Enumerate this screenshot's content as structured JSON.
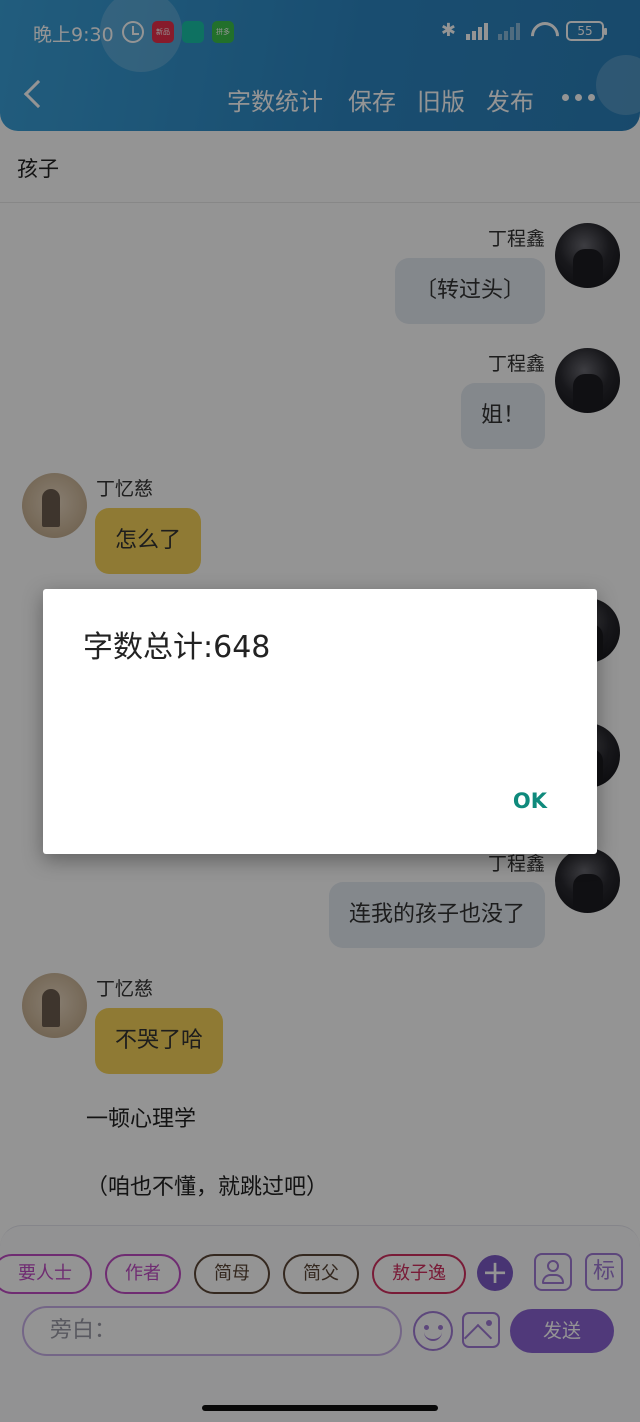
{
  "status_bar": {
    "time": "晚上9:30",
    "battery": "55",
    "app_icons": [
      {
        "label": "新品",
        "color": "#e8304a"
      },
      {
        "label": "",
        "color": "#19c3a8"
      },
      {
        "label": "拼多",
        "color": "#3bc24b"
      }
    ]
  },
  "toolbar": {
    "actions": [
      "字数统计",
      "保存",
      "旧版",
      "发布"
    ]
  },
  "title": "孩子",
  "messages": [
    {
      "side": "right",
      "name": "丁程鑫",
      "text": "〔转过头〕"
    },
    {
      "side": "right",
      "name": "丁程鑫",
      "text": "姐！"
    },
    {
      "side": "left",
      "name": "丁忆慈",
      "text": "怎么了"
    },
    {
      "side": "right",
      "name": "丁程鑫",
      "text": "连我的孩子也没了"
    },
    {
      "side": "left",
      "name": "丁忆慈",
      "text": "不哭了哈"
    }
  ],
  "narrations": [
    "一顿心理学",
    "（咱也不懂，就跳过吧）"
  ],
  "role_chips": [
    {
      "label": "要人士",
      "color": "#c04cc4"
    },
    {
      "label": "作者",
      "color": "#c04cc4"
    },
    {
      "label": "简母",
      "color": "#5a4636"
    },
    {
      "label": "简父",
      "color": "#5a4636"
    },
    {
      "label": "敖子逸",
      "color": "#d03060"
    }
  ],
  "side_icon_label": "标",
  "input": {
    "placeholder": "旁白："
  },
  "send_label": "发送",
  "dialog": {
    "message": "字数总计:648",
    "ok_label": "OK"
  },
  "colors": {
    "header": "#2c86c2",
    "accent": "#8a63d2",
    "left_bubble": "#f6d35a",
    "right_bubble": "#e3eaf2",
    "dialog_button": "#0f8a7c"
  }
}
